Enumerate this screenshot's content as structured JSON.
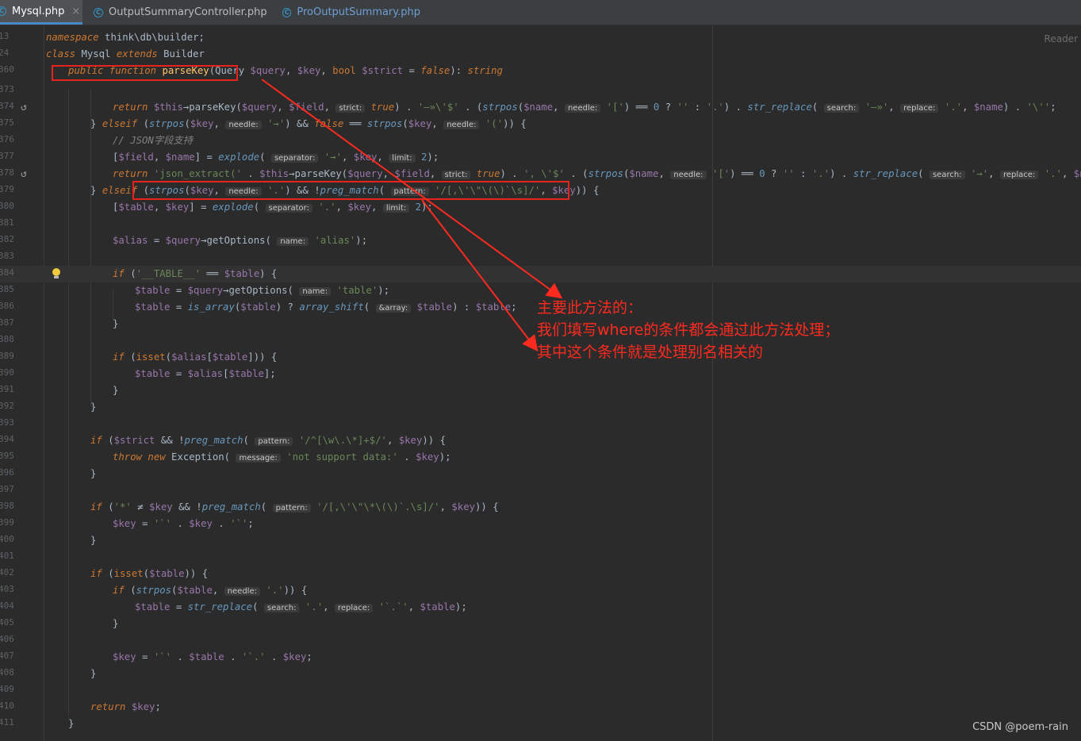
{
  "tabs": [
    {
      "label": "Mysql.php",
      "active": true,
      "closable": true
    },
    {
      "label": "OutputSummaryController.php",
      "active": false
    },
    {
      "label": "ProOutputSummary.php",
      "active": false
    }
  ],
  "reader_label": "Reader",
  "line_numbers": [
    "13",
    "24",
    "360",
    "373",
    "374",
    "375",
    "376",
    "377",
    "378",
    "379",
    "380",
    "381",
    "382",
    "383",
    "384",
    "385",
    "386",
    "387",
    "388",
    "389",
    "390",
    "391",
    "392",
    "393",
    "394",
    "395",
    "396",
    "397",
    "398",
    "399",
    "400",
    "401",
    "402",
    "403",
    "404",
    "405",
    "406",
    "407",
    "408",
    "409",
    "410",
    "411"
  ],
  "annotation": {
    "line1": "主要此方法的：",
    "line2": "我们填写where的条件都会通过此方法处理；",
    "line3": "其中这个条件就是处理别名相关的"
  },
  "watermark": "CSDN @poem-rain",
  "colors": {
    "annotation": "#ff2a1f",
    "editor_bg": "#2b2b2b",
    "keyword": "#cc7832",
    "string": "#6a8759",
    "variable": "#9876aa"
  }
}
